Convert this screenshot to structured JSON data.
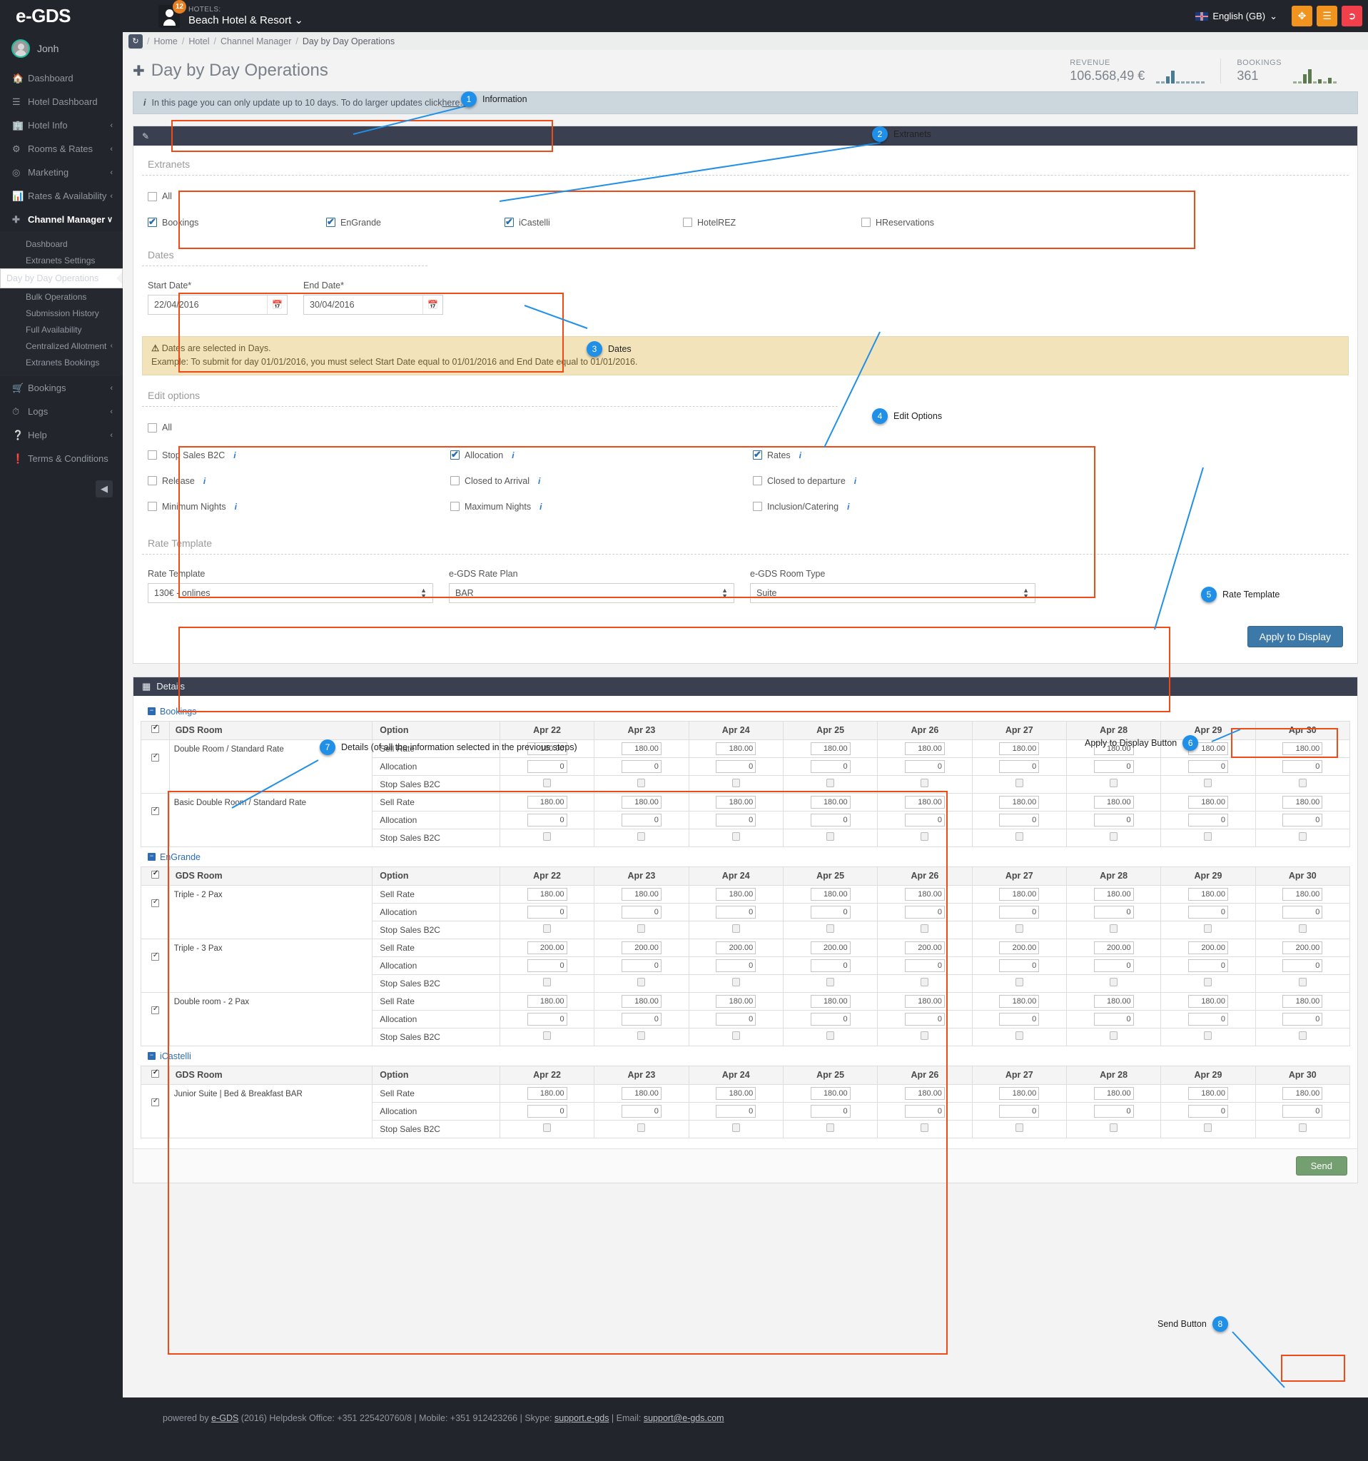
{
  "app": {
    "logo": "e-GDS",
    "notification_count": "12",
    "hotels_label": "HOTELS:",
    "hotel_name": "Beach Hotel & Resort",
    "language": "English (GB)",
    "user_name": "Jonh"
  },
  "breadcrumb": {
    "items": [
      "Home",
      "Hotel",
      "Channel Manager",
      "Day by Day Operations"
    ]
  },
  "sidebar": {
    "items": [
      {
        "label": "Dashboard",
        "icon": "home-icon",
        "caret": ""
      },
      {
        "label": "Hotel Dashboard",
        "icon": "bars-icon",
        "caret": ""
      },
      {
        "label": "Hotel Info",
        "icon": "building-icon",
        "caret": "‹"
      },
      {
        "label": "Rooms & Rates",
        "icon": "gears-icon",
        "caret": "‹"
      },
      {
        "label": "Marketing",
        "icon": "target-icon",
        "caret": "‹"
      },
      {
        "label": "Rates & Availability",
        "icon": "chart-icon",
        "caret": "‹"
      },
      {
        "label": "Channel Manager",
        "icon": "move-icon",
        "caret": "∨"
      }
    ],
    "sub_items": [
      {
        "label": "Dashboard",
        "caret": ""
      },
      {
        "label": "Extranets Settings",
        "caret": ""
      },
      {
        "label": "Day by Day Operations",
        "caret": ""
      },
      {
        "label": "Bulk Operations",
        "caret": ""
      },
      {
        "label": "Submission History",
        "caret": ""
      },
      {
        "label": "Full Availability",
        "caret": ""
      },
      {
        "label": "Centralized Allotment",
        "caret": "‹"
      },
      {
        "label": "Extranets Bookings",
        "caret": ""
      }
    ],
    "bottom_items": [
      {
        "label": "Bookings",
        "icon": "cart-icon",
        "caret": "‹"
      },
      {
        "label": "Logs",
        "icon": "clock-icon",
        "caret": "‹"
      },
      {
        "label": "Help",
        "icon": "question-icon",
        "caret": "‹"
      },
      {
        "label": "Terms & Conditions",
        "icon": "exclamation-icon",
        "caret": ""
      }
    ]
  },
  "page": {
    "title": "Day by Day Operations",
    "kpis": [
      {
        "label": "REVENUE",
        "value": "106.568,49 €",
        "color": "#4a7b94"
      },
      {
        "label": "BOOKINGS",
        "value": "361",
        "color": "#5c7a4e"
      }
    ]
  },
  "alert_info": {
    "text_before": "In this page you can only update up to 10 days. To do larger updates click ",
    "link": "here",
    "text_after": "."
  },
  "extranets": {
    "title": "Extranets",
    "all_label": "All",
    "all_checked": false,
    "options": [
      {
        "label": "Bookings",
        "checked": true
      },
      {
        "label": "EnGrande",
        "checked": true
      },
      {
        "label": "iCastelli",
        "checked": true
      },
      {
        "label": "HotelREZ",
        "checked": false
      },
      {
        "label": "HReservations",
        "checked": false
      }
    ]
  },
  "dates": {
    "title": "Dates",
    "start_label": "Start Date*",
    "start_value": "22/04/2016",
    "end_label": "End Date*",
    "end_value": "30/04/2016"
  },
  "alert_warn": {
    "line1": "Dates are selected in Days.",
    "line2": "Example: To submit for day 01/01/2016, you must select Start Date equal to 01/01/2016 and End Date equal to 01/01/2016."
  },
  "edit_options": {
    "title": "Edit options",
    "all_label": "All",
    "all_checked": false,
    "rows": [
      [
        {
          "label": "Stop Sales B2C",
          "checked": false,
          "info": true
        },
        {
          "label": "Allocation",
          "checked": true,
          "info": true
        },
        {
          "label": "Rates",
          "checked": true,
          "info": true
        }
      ],
      [
        {
          "label": "Release",
          "checked": false,
          "info": true
        },
        {
          "label": "Closed to Arrival",
          "checked": false,
          "info": true
        },
        {
          "label": "Closed to departure",
          "checked": false,
          "info": true
        }
      ],
      [
        {
          "label": "Minimum Nights",
          "checked": false,
          "info": true
        },
        {
          "label": "Maximum Nights",
          "checked": false,
          "info": true
        },
        {
          "label": "Inclusion/Catering",
          "checked": false,
          "info": true
        }
      ]
    ]
  },
  "rate_template": {
    "title": "Rate Template",
    "fields": [
      {
        "label": "Rate Template",
        "value": "130€ - onlines"
      },
      {
        "label": "e-GDS Rate Plan",
        "value": "BAR"
      },
      {
        "label": "e-GDS Room Type",
        "value": "Suite"
      }
    ]
  },
  "apply_button": {
    "label": "Apply to Display"
  },
  "send_button": {
    "label": "Send"
  },
  "details": {
    "title": "Details",
    "columns": [
      "GDS Room",
      "Option",
      "Apr 22",
      "Apr 23",
      "Apr 24",
      "Apr 25",
      "Apr 26",
      "Apr 27",
      "Apr 28",
      "Apr 29",
      "Apr 30"
    ],
    "option_labels": [
      "Sell Rate",
      "Allocation",
      "Stop Sales B2C"
    ],
    "groups": [
      {
        "name": "Bookings",
        "rooms": [
          {
            "name": "Double Room / Standard Rate",
            "checked": true,
            "sell_rate": [
              "180.00",
              "180.00",
              "180.00",
              "180.00",
              "180.00",
              "180.00",
              "180.00",
              "180.00",
              "180.00"
            ],
            "allocation": [
              "0",
              "0",
              "0",
              "0",
              "0",
              "0",
              "0",
              "0",
              "0"
            ],
            "stop_sales": [
              false,
              false,
              false,
              false,
              false,
              false,
              false,
              false,
              false
            ]
          },
          {
            "name": "Basic Double Room / Standard Rate",
            "checked": true,
            "sell_rate": [
              "180.00",
              "180.00",
              "180.00",
              "180.00",
              "180.00",
              "180.00",
              "180.00",
              "180.00",
              "180.00"
            ],
            "allocation": [
              "0",
              "0",
              "0",
              "0",
              "0",
              "0",
              "0",
              "0",
              "0"
            ],
            "stop_sales": [
              false,
              false,
              false,
              false,
              false,
              false,
              false,
              false,
              false
            ]
          }
        ]
      },
      {
        "name": "EnGrande",
        "rooms": [
          {
            "name": "Triple - 2 Pax",
            "checked": true,
            "sell_rate": [
              "180.00",
              "180.00",
              "180.00",
              "180.00",
              "180.00",
              "180.00",
              "180.00",
              "180.00",
              "180.00"
            ],
            "allocation": [
              "0",
              "0",
              "0",
              "0",
              "0",
              "0",
              "0",
              "0",
              "0"
            ],
            "stop_sales": [
              false,
              false,
              false,
              false,
              false,
              false,
              false,
              false,
              false
            ]
          },
          {
            "name": "Triple - 3 Pax",
            "checked": true,
            "sell_rate": [
              "200.00",
              "200.00",
              "200.00",
              "200.00",
              "200.00",
              "200.00",
              "200.00",
              "200.00",
              "200.00"
            ],
            "allocation": [
              "0",
              "0",
              "0",
              "0",
              "0",
              "0",
              "0",
              "0",
              "0"
            ],
            "stop_sales": [
              false,
              false,
              false,
              false,
              false,
              false,
              false,
              false,
              false
            ]
          },
          {
            "name": "Double room - 2 Pax",
            "checked": true,
            "sell_rate": [
              "180.00",
              "180.00",
              "180.00",
              "180.00",
              "180.00",
              "180.00",
              "180.00",
              "180.00",
              "180.00"
            ],
            "allocation": [
              "0",
              "0",
              "0",
              "0",
              "0",
              "0",
              "0",
              "0",
              "0"
            ],
            "stop_sales": [
              false,
              false,
              false,
              false,
              false,
              false,
              false,
              false,
              false
            ]
          }
        ]
      },
      {
        "name": "iCastelli",
        "rooms": [
          {
            "name": "Junior Suite | Bed & Breakfast BAR",
            "checked": true,
            "sell_rate": [
              "180.00",
              "180.00",
              "180.00",
              "180.00",
              "180.00",
              "180.00",
              "180.00",
              "180.00",
              "180.00"
            ],
            "allocation": [
              "0",
              "0",
              "0",
              "0",
              "0",
              "0",
              "0",
              "0",
              "0"
            ],
            "stop_sales": [
              false,
              false,
              false,
              false,
              false,
              false,
              false,
              false,
              false
            ]
          }
        ]
      }
    ]
  },
  "annotations": [
    {
      "num": "1",
      "label": "Information"
    },
    {
      "num": "2",
      "label": "Extranets"
    },
    {
      "num": "3",
      "label": "Dates"
    },
    {
      "num": "4",
      "label": "Edit Options"
    },
    {
      "num": "5",
      "label": "Rate Template"
    },
    {
      "num": "6",
      "label": "Apply to Display Button"
    },
    {
      "num": "7",
      "label": "Details (of all the information selected in the previous steps)"
    },
    {
      "num": "8",
      "label": "Send Button"
    }
  ],
  "footer": {
    "prefix": "powered by ",
    "brand": "e-GDS",
    "year": " (2016) Helpdesk Office: +351 225420760/8  |  Mobile: +351 912423266  |  Skype: ",
    "skype": "support.e-gds",
    "mid": "  |  Email: ",
    "email": "support@e-gds.com"
  }
}
